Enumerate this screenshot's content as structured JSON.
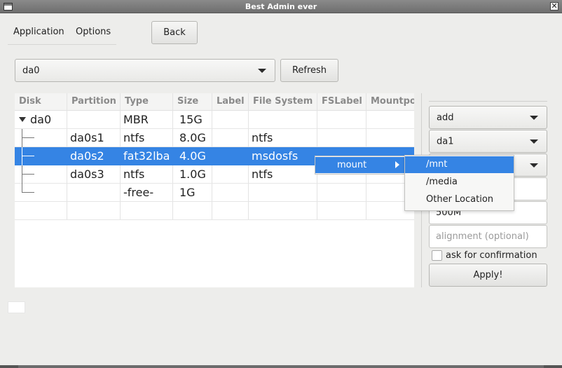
{
  "window": {
    "title": "Best Admin ever",
    "close_glyph": "✕"
  },
  "menubar": {
    "application": "Application",
    "options": "Options"
  },
  "toolbar": {
    "back_label": "Back",
    "refresh_label": "Refresh"
  },
  "disk_combo": {
    "value": "da0"
  },
  "table": {
    "columns": [
      "Disk",
      "Partition",
      "Type",
      "Size",
      "Label",
      "File System",
      "FSLabel",
      "Mountpo"
    ],
    "rows": [
      {
        "disk": "da0",
        "partition": "",
        "type": "MBR",
        "size": "15G",
        "label": "",
        "fs": "",
        "fslabel": "",
        "mount": ""
      },
      {
        "disk": "",
        "partition": "da0s1",
        "type": "ntfs",
        "size": "8.0G",
        "label": "",
        "fs": "ntfs",
        "fslabel": "",
        "mount": ""
      },
      {
        "disk": "",
        "partition": "da0s2",
        "type": "fat32lba",
        "size": "4.0G",
        "label": "",
        "fs": "msdosfs",
        "fslabel": "",
        "mount": ""
      },
      {
        "disk": "",
        "partition": "da0s3",
        "type": "ntfs",
        "size": "1.0G",
        "label": "",
        "fs": "ntfs",
        "fslabel": "",
        "mount": ""
      },
      {
        "disk": "",
        "partition": "",
        "type": "-free-",
        "size": "1G",
        "label": "",
        "fs": "",
        "fslabel": "",
        "mount": ""
      }
    ],
    "selected_row": 2
  },
  "context_menu": {
    "item": "mount",
    "submenu": [
      "/mnt",
      "/media",
      "Other Location"
    ],
    "highlighted": "/mnt"
  },
  "right_panel": {
    "action_combo": "add",
    "disk_combo": "da1",
    "size_value": "500M",
    "alignment_placeholder": "alignment (optional)",
    "confirm_label": "ask for confirmation",
    "confirm_checked": false,
    "apply_label": "Apply!"
  },
  "colors": {
    "selection": "#3584e4",
    "titlebar": "#7a7a7a"
  },
  "icons": {
    "window": "window-icon",
    "close": "close-icon",
    "dropdown": "chevron-down-icon",
    "submenu": "chevron-right-icon"
  }
}
